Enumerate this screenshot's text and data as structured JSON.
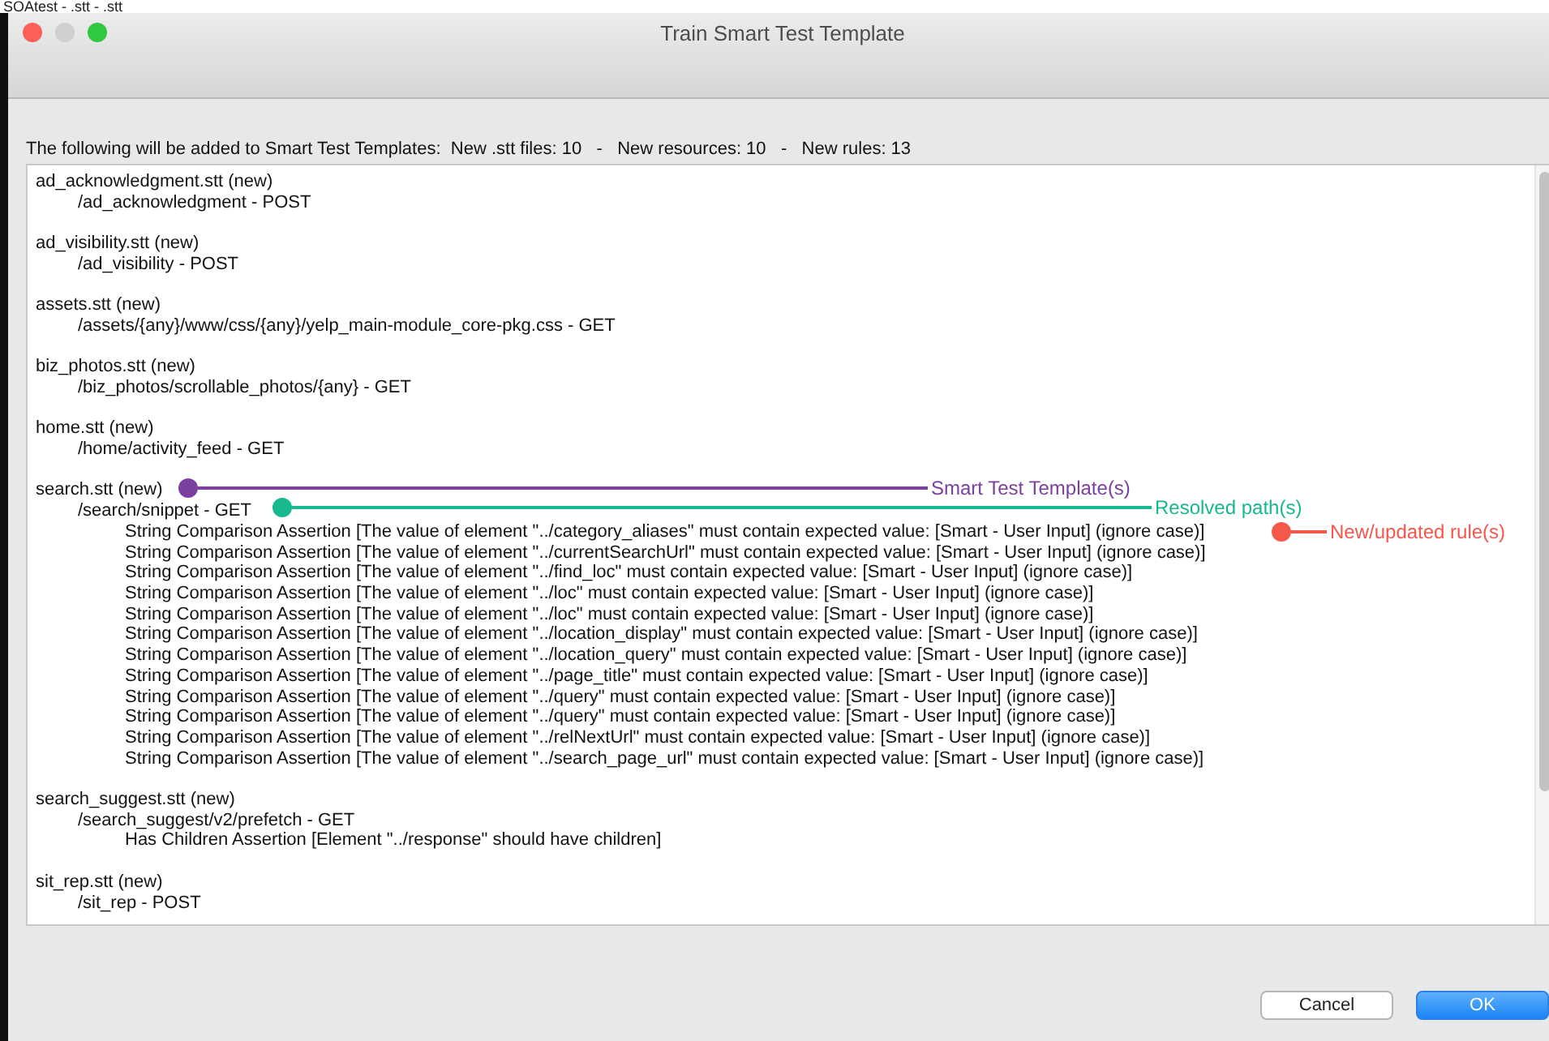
{
  "background_title": "SOAtest - .stt - .stt",
  "window": {
    "title": "Train Smart Test Template"
  },
  "summary": "The following will be added to Smart Test Templates:  New .stt files: 10   -   New resources: 10   -   New rules: 13",
  "files": [
    {
      "name": "ad_acknowledgment.stt (new)",
      "paths": [
        {
          "path": "/ad_acknowledgment - POST"
        }
      ]
    },
    {
      "name": "ad_visibility.stt (new)",
      "paths": [
        {
          "path": "/ad_visibility - POST"
        }
      ]
    },
    {
      "name": "assets.stt (new)",
      "paths": [
        {
          "path": "/assets/{any}/www/css/{any}/yelp_main-module_core-pkg.css - GET"
        }
      ]
    },
    {
      "name": "biz_photos.stt (new)",
      "paths": [
        {
          "path": "/biz_photos/scrollable_photos/{any} - GET"
        }
      ]
    },
    {
      "name": "home.stt (new)",
      "paths": [
        {
          "path": "/home/activity_feed - GET"
        }
      ]
    },
    {
      "name": "search.stt (new)",
      "paths": [
        {
          "path": "/search/snippet - GET",
          "rules": [
            "String Comparison Assertion [The value of element \"../category_aliases\" must contain expected value: [Smart - User Input] (ignore case)]",
            "String Comparison Assertion [The value of element \"../currentSearchUrl\" must contain expected value: [Smart - User Input] (ignore case)]",
            "String Comparison Assertion [The value of element \"../find_loc\" must contain expected value: [Smart - User Input] (ignore case)]",
            "String Comparison Assertion [The value of element \"../loc\" must contain expected value: [Smart - User Input] (ignore case)]",
            "String Comparison Assertion [The value of element \"../loc\" must contain expected value: [Smart - User Input] (ignore case)]",
            "String Comparison Assertion [The value of element \"../location_display\" must contain expected value: [Smart - User Input] (ignore case)]",
            "String Comparison Assertion [The value of element \"../location_query\" must contain expected value: [Smart - User Input] (ignore case)]",
            "String Comparison Assertion [The value of element \"../page_title\" must contain expected value: [Smart - User Input] (ignore case)]",
            "String Comparison Assertion [The value of element \"../query\" must contain expected value: [Smart - User Input] (ignore case)]",
            "String Comparison Assertion [The value of element \"../query\" must contain expected value: [Smart - User Input] (ignore case)]",
            "String Comparison Assertion [The value of element \"../relNextUrl\" must contain expected value: [Smart - User Input] (ignore case)]",
            "String Comparison Assertion [The value of element \"../search_page_url\" must contain expected value: [Smart - User Input] (ignore case)]"
          ]
        }
      ]
    },
    {
      "name": "search_suggest.stt (new)",
      "paths": [
        {
          "path": "/search_suggest/v2/prefetch - GET",
          "rules": [
            "Has Children Assertion [Element \"../response\" should have children]"
          ]
        }
      ]
    },
    {
      "name": "sit_rep.stt (new)",
      "paths": [
        {
          "path": "/sit_rep - POST"
        }
      ]
    }
  ],
  "annotations": [
    {
      "label": "Smart Test Template(s)",
      "color": "#7b3fa0"
    },
    {
      "label": "Resolved path(s)",
      "color": "#17b890"
    },
    {
      "label": "New/updated rule(s)",
      "color": "#f5574b"
    }
  ],
  "buttons": [
    {
      "label": "Cancel",
      "kind": "secondary"
    },
    {
      "label": "OK",
      "kind": "primary"
    }
  ]
}
